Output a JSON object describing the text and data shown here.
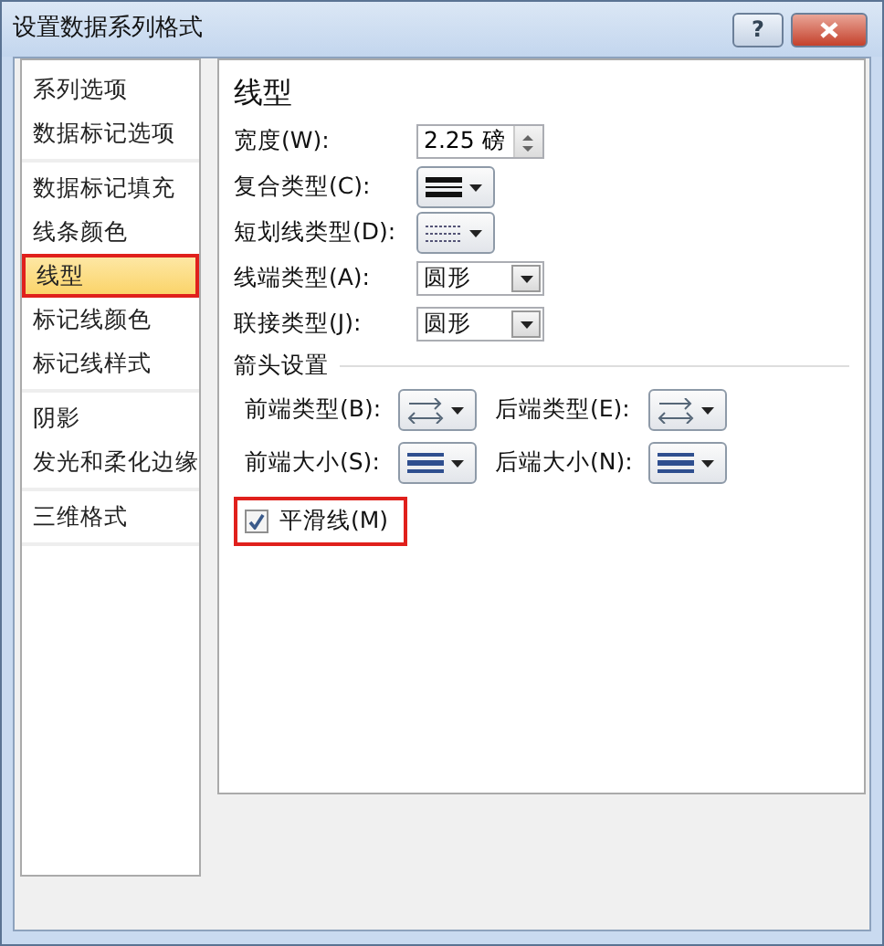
{
  "window": {
    "title": "设置数据系列格式",
    "help": "?"
  },
  "sidebar": {
    "groups": [
      {
        "items": [
          {
            "label": "系列选项",
            "selected": false,
            "highlighted": false
          },
          {
            "label": "数据标记选项",
            "selected": false,
            "highlighted": false
          }
        ]
      },
      {
        "items": [
          {
            "label": "数据标记填充",
            "selected": false,
            "highlighted": false
          },
          {
            "label": "线条颜色",
            "selected": false,
            "highlighted": false
          },
          {
            "label": "线型",
            "selected": true,
            "highlighted": true
          },
          {
            "label": "标记线颜色",
            "selected": false,
            "highlighted": false
          },
          {
            "label": "标记线样式",
            "selected": false,
            "highlighted": false
          }
        ]
      },
      {
        "items": [
          {
            "label": "阴影",
            "selected": false,
            "highlighted": false
          },
          {
            "label": "发光和柔化边缘",
            "selected": false,
            "highlighted": false
          }
        ]
      },
      {
        "items": [
          {
            "label": "三维格式",
            "selected": false,
            "highlighted": false
          }
        ]
      }
    ]
  },
  "panel": {
    "title": "线型",
    "fields": [
      {
        "kind": "spinner",
        "label": "宽度(W):",
        "value": "2.25 磅"
      },
      {
        "kind": "compound",
        "label": "复合类型(C):"
      },
      {
        "kind": "dash",
        "label": "短划线类型(D):"
      },
      {
        "kind": "select",
        "label": "线端类型(A):",
        "value": "圆形"
      },
      {
        "kind": "select",
        "label": "联接类型(J):",
        "value": "圆形"
      }
    ],
    "arrow_section": {
      "title": "箭头设置",
      "rows": [
        [
          {
            "kind": "arrow",
            "label": "前端类型(B):"
          },
          {
            "kind": "arrow",
            "label": "后端类型(E):"
          }
        ],
        [
          {
            "kind": "size",
            "label": "前端大小(S):"
          },
          {
            "kind": "size",
            "label": "后端大小(N):"
          }
        ]
      ]
    },
    "smooth_line": {
      "label": "平滑线(M)",
      "checked": true,
      "highlighted": true
    }
  }
}
